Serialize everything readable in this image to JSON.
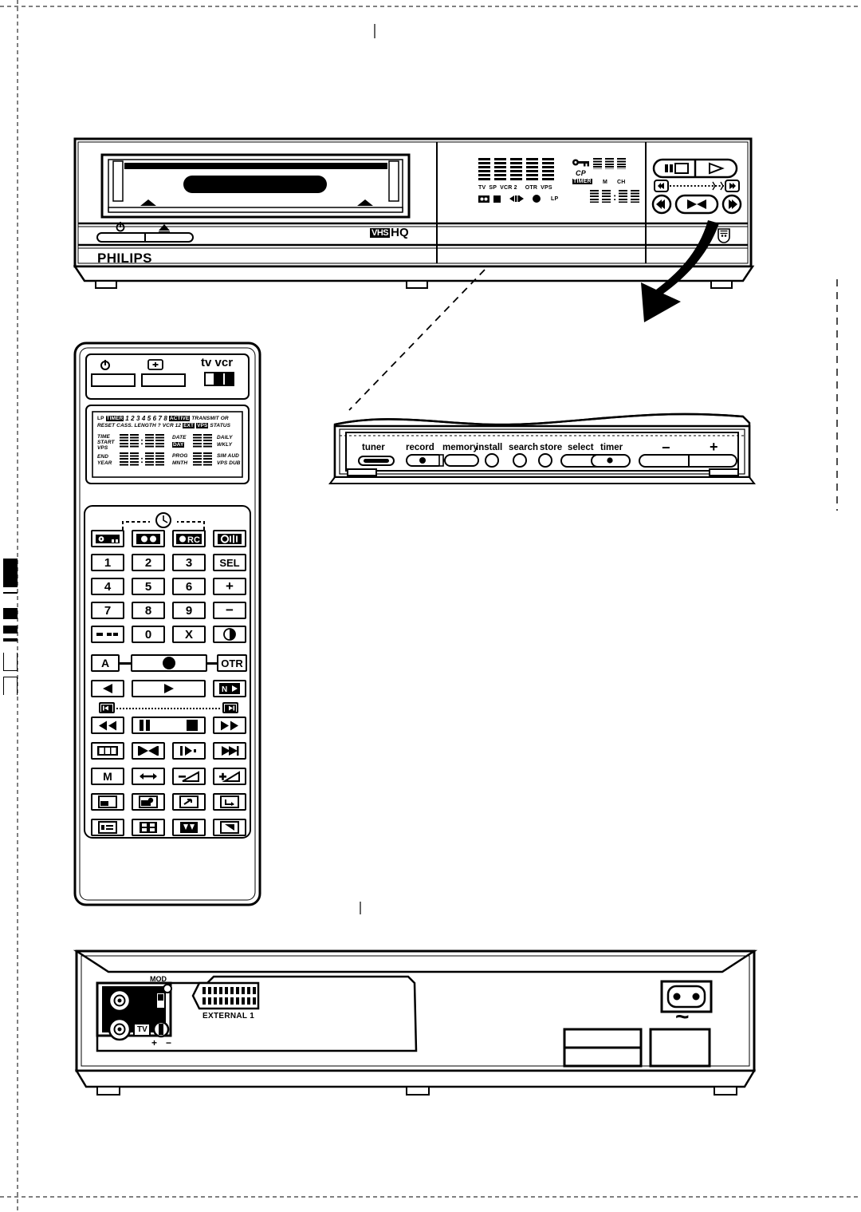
{
  "page": {
    "document_type": "vcr-user-manual-illustration",
    "brand": "PHILIPS",
    "format_logo_vhs": "VHS",
    "format_logo_hq": "HQ"
  },
  "front_panel": {
    "brand": "PHILIPS",
    "power_icon": "power-standby-icon",
    "eject_icon": "eject-icon",
    "format_logo": "VHS HQ",
    "philips_shield": "philips-shield-emblem",
    "display": {
      "indicator_row_1": [
        "TV",
        "SP",
        "VCR 2",
        "OTR",
        "VPS"
      ],
      "indicator_row_2": [
        "cassette-icon",
        "stop-icon",
        "rewind-icon",
        "pause-icon",
        "play-icon",
        "record-icon",
        "LP"
      ],
      "right_labels": [
        "CP",
        "TIMER",
        "M",
        "CH"
      ],
      "key_icon": "key-icon",
      "clock_value": "88:88",
      "counter_value": "888",
      "channel_value": "88"
    },
    "transport": {
      "pause_label": "pause-still-icon",
      "play_label": "play-icon",
      "rewind_search_icon": "rewind-search-icon",
      "forward_search_icon": "forward-search-icon",
      "rewind_icon": "rewind-icon",
      "stop_eject_icon": "stop-eject-icon",
      "forward_icon": "fast-forward-icon"
    }
  },
  "flip_panel": {
    "title": "flip-down-control-panel",
    "buttons": [
      {
        "label": "tuner",
        "type": "bar"
      },
      {
        "label": "record",
        "type": "bar-dot"
      },
      {
        "label": "memory",
        "type": "bar"
      },
      {
        "label": "install",
        "type": "round"
      },
      {
        "label": "search",
        "type": "round"
      },
      {
        "label": "store",
        "type": "round"
      },
      {
        "label": "select",
        "type": "bar"
      },
      {
        "label": "timer",
        "type": "bar-dot"
      },
      {
        "label": "−",
        "type": "rocker-minus"
      },
      {
        "label": "+",
        "type": "rocker-plus"
      }
    ]
  },
  "remote": {
    "top_buttons": [
      {
        "name": "standby-button",
        "icon": "power-standby-icon"
      },
      {
        "name": "plus-button",
        "icon": "plus-boxed-icon"
      }
    ],
    "tv_vcr_switch": {
      "label_tv": "tv",
      "label_vcr": "vcr"
    },
    "lcd": {
      "row1": [
        "LP",
        "TIMER",
        "1 2 3 4 5 6 7 8",
        "ACTIVE",
        "TRANSMIT",
        "OR"
      ],
      "row2": [
        "RESET",
        "CASS. LENGTH ?",
        "VCR 12",
        "EXT",
        "VPS",
        "STATUS"
      ],
      "left_labels_a": [
        "TIME",
        "START",
        "VPS"
      ],
      "left_labels_b": [
        "END",
        "YEAR"
      ],
      "time_value": "88:88",
      "end_value": "88:88",
      "date_label": "DATE",
      "date_sub": "DAY",
      "date_value": "88",
      "daily_label": "DAILY",
      "wkly_label": "WKLY",
      "prog_label": "PROG",
      "mnth_label": "MNTH",
      "prog_value": "88",
      "sim_aud_label": "SIM AUD",
      "vps_dub_label": "VPS DUB"
    },
    "timer_bracket_icon": "clock-icon",
    "keys": [
      [
        {
          "t": "key-icon",
          "k": "icon"
        },
        {
          "t": "cassette-icon",
          "k": "icon"
        },
        {
          "t": "RC",
          "k": "rec-rc"
        },
        {
          "t": "sound-icon",
          "k": "icon"
        }
      ],
      [
        {
          "t": "1",
          "k": "num"
        },
        {
          "t": "2",
          "k": "num"
        },
        {
          "t": "3",
          "k": "num"
        },
        {
          "t": "SEL",
          "k": "txt"
        }
      ],
      [
        {
          "t": "4",
          "k": "num"
        },
        {
          "t": "5",
          "k": "num"
        },
        {
          "t": "6",
          "k": "num"
        },
        {
          "t": "+",
          "k": "txt"
        }
      ],
      [
        {
          "t": "7",
          "k": "num"
        },
        {
          "t": "8",
          "k": "num"
        },
        {
          "t": "9",
          "k": "num"
        },
        {
          "t": "−",
          "k": "txt"
        }
      ],
      [
        {
          "t": "dash-icon",
          "k": "icon"
        },
        {
          "t": "0",
          "k": "num"
        },
        {
          "t": "X",
          "k": "txt"
        },
        {
          "t": "contrast-icon",
          "k": "icon"
        }
      ]
    ],
    "record_row": {
      "left": "A",
      "center": "record-icon",
      "right": "OTR"
    },
    "play_row": {
      "left": "reverse-play-icon",
      "center": "play-icon",
      "right": "ND"
    },
    "shuttle": {
      "left": "slow-rewind-icon",
      "right": "slow-forward-icon"
    },
    "transport_row": {
      "left": "rewind-icon",
      "center_pause": "pause-icon",
      "center_stop": "stop-icon",
      "right": "fast-forward-icon"
    },
    "index_row": [
      "counter-reset-icon",
      "index-search-icon",
      "slow-motion-icon",
      "index-next-icon"
    ],
    "func_row": [
      "M",
      "tracking-icon",
      "volume-down-icon",
      "volume-up-icon"
    ],
    "pip_row_1": [
      "picture-store-icon",
      "picture-camera-icon",
      "picture-swap-icon",
      "picture-insert-icon"
    ],
    "pip_row_2": [
      "picture-list-icon",
      "picture-multi-icon",
      "picture-mask-icon",
      "picture-move-icon"
    ]
  },
  "rear_panel": {
    "aerial_in_icon": "aerial-in-icon",
    "tv_out_label": "TV",
    "mod_upper_label": "MOD",
    "mod_upper_state": "O",
    "mod_lower_label": "MOD",
    "mod_lower_state": "|",
    "tuning_plus": "+",
    "tuning_minus": "−",
    "scart_label": "EXTERNAL 1",
    "mains_symbol": "~",
    "mains_socket": "mains-inlet-icon"
  }
}
